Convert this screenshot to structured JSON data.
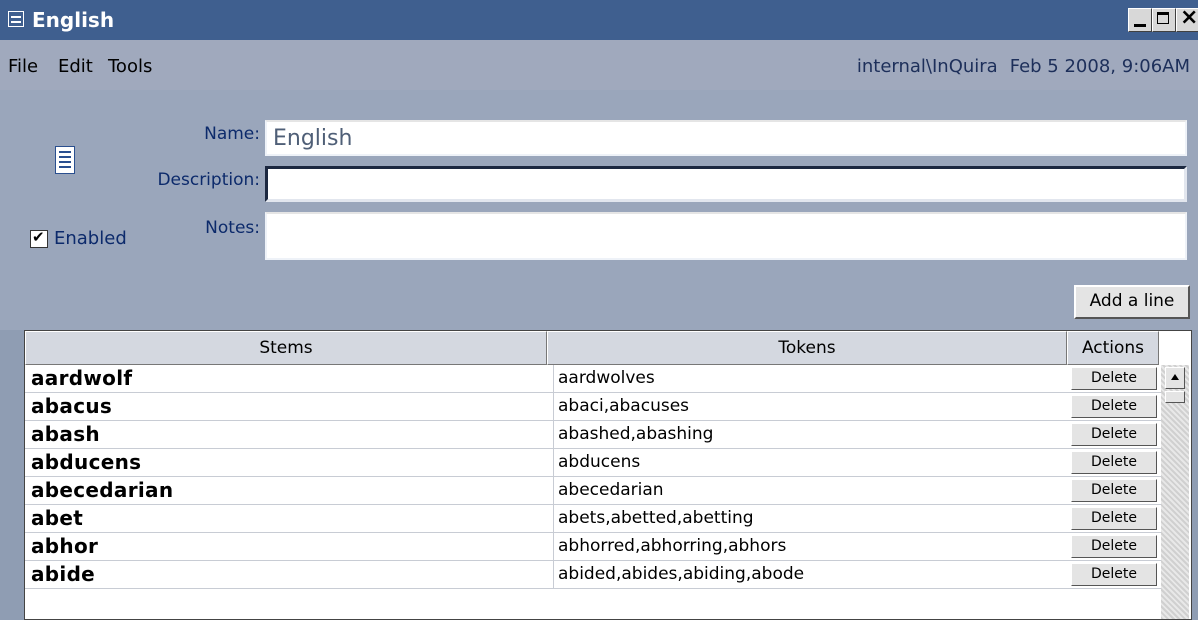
{
  "window": {
    "title": "English"
  },
  "menu": {
    "file": "File",
    "edit": "Edit",
    "tools": "Tools",
    "user": "internal\\InQuira",
    "timestamp": "Feb 5 2008, 9:06AM"
  },
  "form": {
    "name_label": "Name:",
    "name_value": "English",
    "description_label": "Description:",
    "description_value": "",
    "notes_label": "Notes:",
    "notes_value": "",
    "enabled_label": "Enabled",
    "enabled_checked": true,
    "add_line_label": "Add a line"
  },
  "table": {
    "headers": {
      "stems": "Stems",
      "tokens": "Tokens",
      "actions": "Actions"
    },
    "delete_label": "Delete",
    "rows": [
      {
        "stem": "aardwolf",
        "tokens": "aardwolves"
      },
      {
        "stem": "abacus",
        "tokens": "abaci,abacuses"
      },
      {
        "stem": "abash",
        "tokens": "abashed,abashing"
      },
      {
        "stem": "abducens",
        "tokens": "abducens"
      },
      {
        "stem": "abecedarian",
        "tokens": "abecedarian"
      },
      {
        "stem": "abet",
        "tokens": "abets,abetted,abetting"
      },
      {
        "stem": "abhor",
        "tokens": "abhorred,abhorring,abhors"
      },
      {
        "stem": "abide",
        "tokens": "abided,abides,abiding,abode"
      }
    ]
  }
}
